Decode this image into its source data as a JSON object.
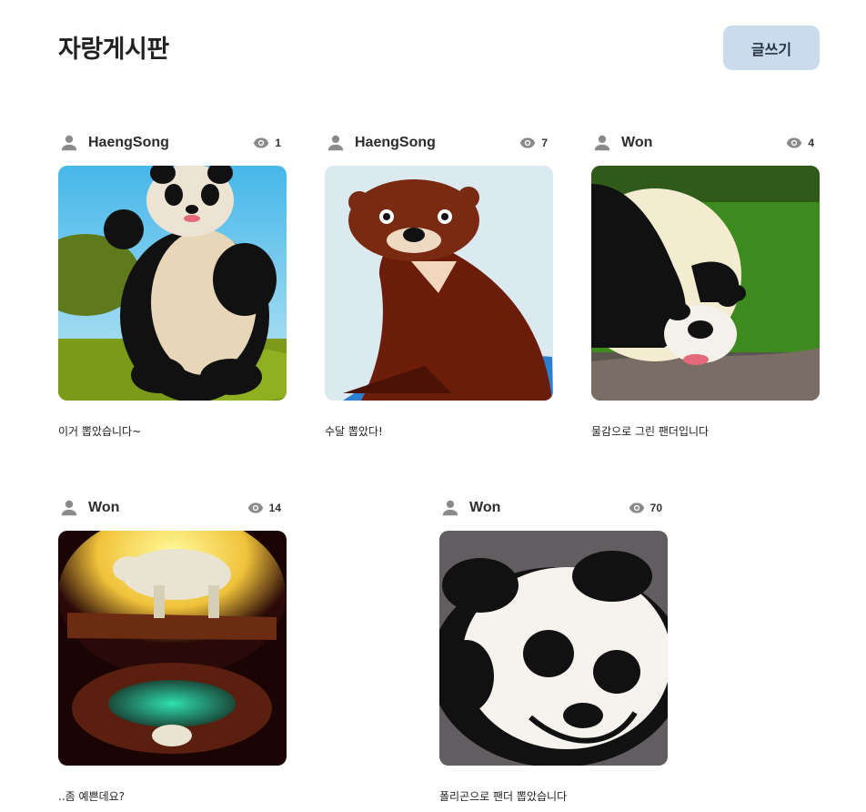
{
  "header": {
    "title": "자랑게시판",
    "write_label": "글쓰기"
  },
  "posts": [
    {
      "author": "HaengSong",
      "views": "1",
      "caption": "이거 뽑았습니다~",
      "image": "panda-cartoon-standing"
    },
    {
      "author": "HaengSong",
      "views": "7",
      "caption": "수달 뽑았다!",
      "image": "otter-illustration"
    },
    {
      "author": "Won",
      "views": "4",
      "caption": "물감으로 그린 팬더입니다",
      "image": "panda-drinking-water"
    },
    {
      "author": "Won",
      "views": "14",
      "caption": "..좀 예쁜데요?",
      "image": "polar-bear-glowing"
    },
    {
      "author": "Won",
      "views": "70",
      "caption": "폴리곤으로 팬더 뽑았습니다",
      "image": "panda-face-closeup"
    }
  ],
  "colors": {
    "accent_button": "#c9dbed",
    "icon_gray": "#8a8a8a"
  },
  "icons": {
    "author": "person-icon",
    "views": "eye-icon"
  }
}
